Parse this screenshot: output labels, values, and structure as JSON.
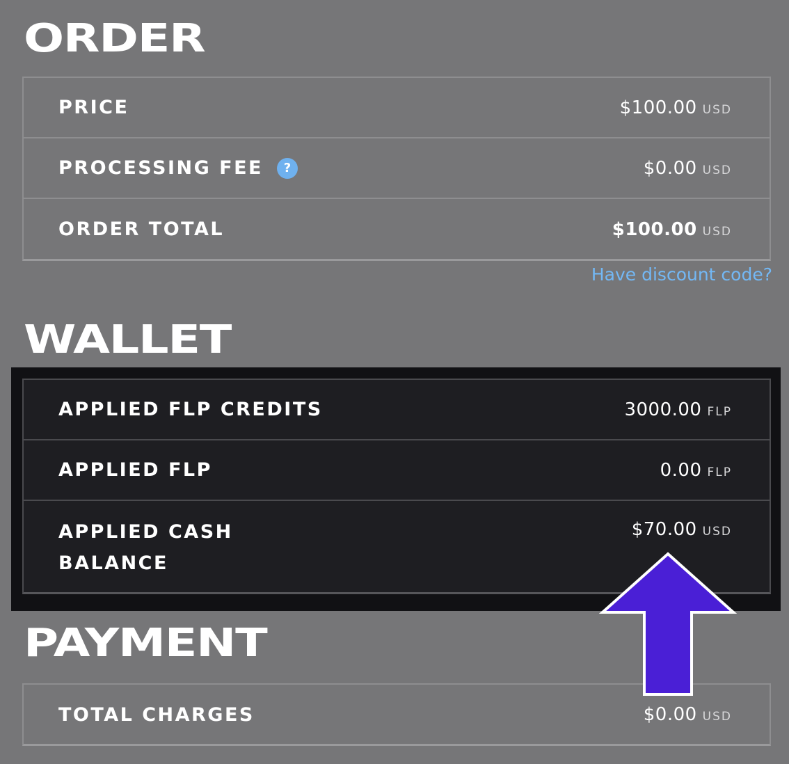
{
  "order": {
    "title": "ORDER",
    "rows": [
      {
        "label": "PRICE",
        "amount": "$100.00",
        "unit": "USD"
      },
      {
        "label": "PROCESSING FEE",
        "amount": "$0.00",
        "unit": "USD",
        "help_icon": "question-circle-icon"
      },
      {
        "label": "ORDER TOTAL",
        "amount": "$100.00",
        "unit": "USD"
      }
    ],
    "discount_link": "Have discount code?"
  },
  "wallet": {
    "title": "WALLET",
    "rows": [
      {
        "label": "APPLIED FLP CREDITS",
        "amount": "3000.00",
        "unit": "FLP"
      },
      {
        "label": "APPLIED FLP",
        "amount": "0.00",
        "unit": "FLP"
      },
      {
        "label_line1": "APPLIED CASH",
        "label_line2": "BALANCE",
        "amount": "$70.00",
        "unit": "USD"
      }
    ]
  },
  "payment": {
    "title": "PAYMENT",
    "rows": [
      {
        "label": "TOTAL CHARGES",
        "amount": "$0.00",
        "unit": "USD"
      }
    ]
  },
  "help_icon_glyph": "?",
  "annotation": {
    "icon": "up-arrow-icon",
    "color": "#4a1fd6"
  },
  "colors": {
    "background": "#767678",
    "wallet_background": "#1e1e22",
    "link": "#73b8f5",
    "help_icon": "#6fb1ef"
  }
}
